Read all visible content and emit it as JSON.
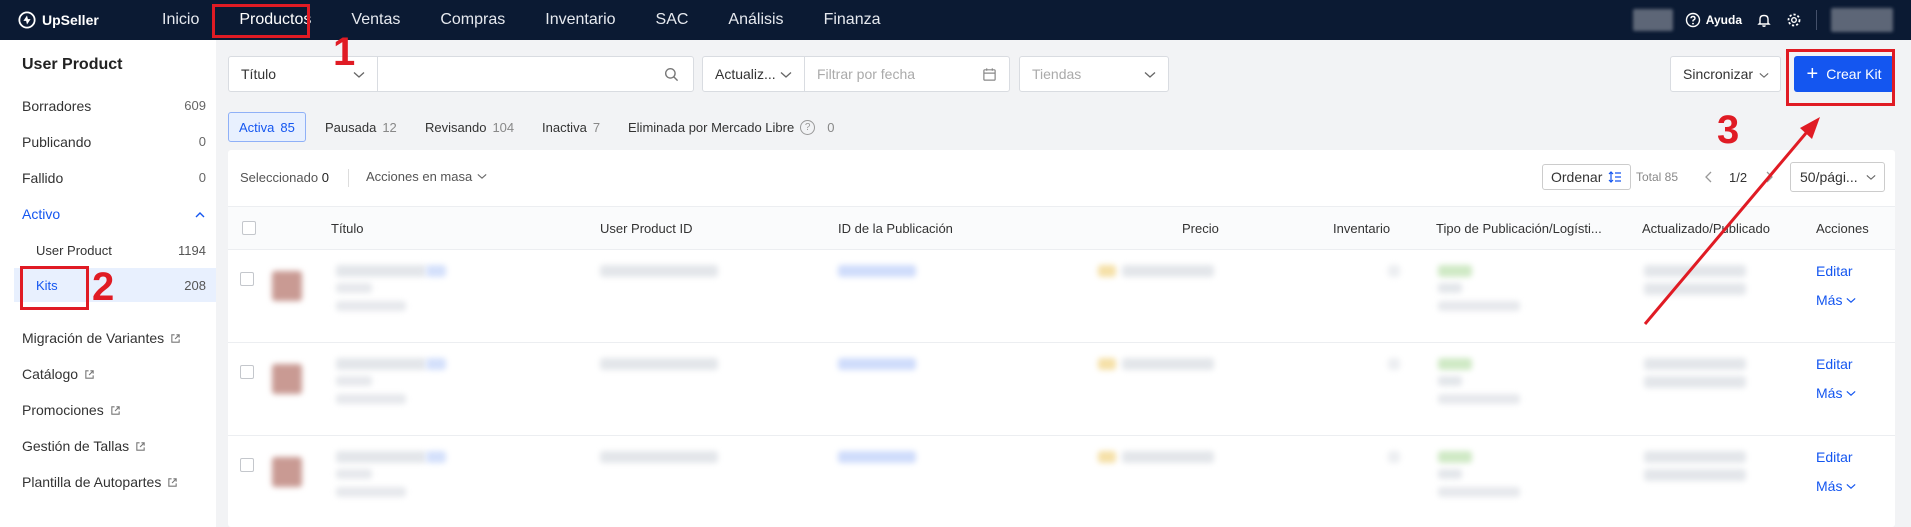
{
  "topnav": {
    "brand": "UpSeller",
    "items": [
      "Inicio",
      "Productos",
      "Ventas",
      "Compras",
      "Inventario",
      "SAC",
      "Análisis",
      "Finanza"
    ],
    "help_label": "Ayuda"
  },
  "sidebar": {
    "title": "User Product",
    "items": [
      {
        "label": "Borradores",
        "count": "609"
      },
      {
        "label": "Publicando",
        "count": "0"
      },
      {
        "label": "Fallido",
        "count": "0"
      },
      {
        "label": "Activo"
      }
    ],
    "subitems": [
      {
        "label": "User Product",
        "count": "1194"
      },
      {
        "label": "Kits",
        "count": "208"
      }
    ],
    "links": [
      "Migración de Variantes",
      "Catálogo",
      "Promociones",
      "Gestión de Tallas",
      "Plantilla de Autopartes"
    ]
  },
  "filters": {
    "field_select": "Título",
    "search_value": "",
    "date_select": "Actualiz...",
    "date_placeholder": "Filtrar por fecha",
    "store_placeholder": "Tiendas",
    "sync_label": "Sincronizar",
    "create_label": "Crear Kit"
  },
  "status_tabs": [
    {
      "label": "Activa",
      "count": "85"
    },
    {
      "label": "Pausada",
      "count": "12"
    },
    {
      "label": "Revisando",
      "count": "104"
    },
    {
      "label": "Inactiva",
      "count": "7"
    },
    {
      "label": "Eliminada por Mercado Libre",
      "count": "0"
    }
  ],
  "toolbar": {
    "selected_label": "Seleccionado",
    "selected_count": "0",
    "bulk_label": "Acciones en masa",
    "order_label": "Ordenar",
    "total_label": "Total 85",
    "page": "1/2",
    "per_page": "50/pági..."
  },
  "table": {
    "columns": [
      "Título",
      "User Product ID",
      "ID de la Publicación",
      "Precio",
      "Inventario",
      "Tipo de Publicación/Logísti...",
      "Actualizado/Publicado",
      "Acciones"
    ],
    "rows": [
      {
        "edit": "Editar",
        "more": "Más"
      },
      {
        "edit": "Editar",
        "more": "Más"
      },
      {
        "edit": "Editar",
        "more": "Más"
      }
    ]
  },
  "annotations": [
    "1",
    "2",
    "3"
  ],
  "colors": {
    "accent": "#1456f0",
    "nav_bg": "#0b1a33",
    "annotation": "#e01b24"
  }
}
